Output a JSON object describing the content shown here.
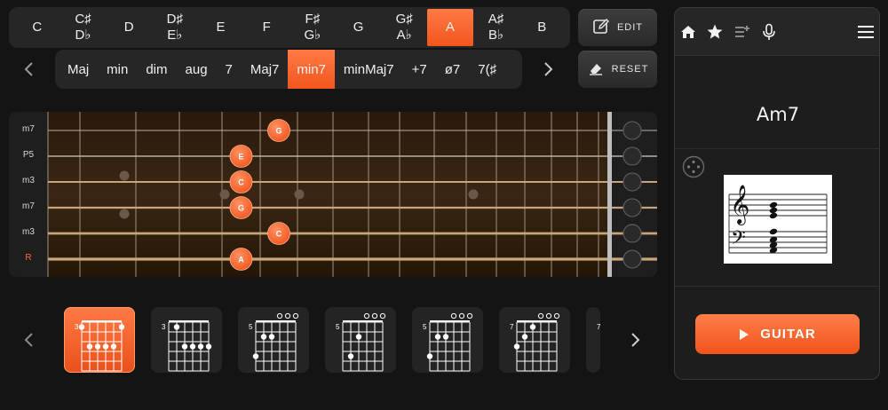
{
  "roots": [
    {
      "label": "C",
      "sub": "",
      "active": false
    },
    {
      "label": "C♯",
      "sub": "D♭",
      "active": false
    },
    {
      "label": "D",
      "sub": "",
      "active": false
    },
    {
      "label": "D♯",
      "sub": "E♭",
      "active": false
    },
    {
      "label": "E",
      "sub": "",
      "active": false
    },
    {
      "label": "F",
      "sub": "",
      "active": false
    },
    {
      "label": "F♯",
      "sub": "G♭",
      "active": false
    },
    {
      "label": "G",
      "sub": "",
      "active": false
    },
    {
      "label": "G♯",
      "sub": "A♭",
      "active": false
    },
    {
      "label": "A",
      "sub": "",
      "active": true
    },
    {
      "label": "A♯",
      "sub": "B♭",
      "active": false
    },
    {
      "label": "B",
      "sub": "",
      "active": false
    }
  ],
  "buttons": {
    "edit": "EDIT",
    "reset": "RESET",
    "play": "GUITAR"
  },
  "qualities": [
    {
      "label": "Maj",
      "active": false
    },
    {
      "label": "min",
      "active": false
    },
    {
      "label": "dim",
      "active": false
    },
    {
      "label": "aug",
      "active": false
    },
    {
      "label": "7",
      "active": false
    },
    {
      "label": "Maj7",
      "active": false
    },
    {
      "label": "min7",
      "active": true
    },
    {
      "label": "minMaj7",
      "active": false
    },
    {
      "label": "+7",
      "active": false
    },
    {
      "label": "ø7",
      "active": false
    },
    {
      "label": "7(♯",
      "active": false
    }
  ],
  "fretboard": {
    "string_labels": [
      "m7",
      "P5",
      "m3",
      "m7",
      "m3",
      "R"
    ],
    "root_string_index": 5,
    "notes": [
      {
        "string": 0,
        "fret": 6,
        "name": "G"
      },
      {
        "string": 1,
        "fret": 5,
        "name": "E"
      },
      {
        "string": 2,
        "fret": 5,
        "name": "C"
      },
      {
        "string": 3,
        "fret": 5,
        "name": "G"
      },
      {
        "string": 4,
        "fret": 6,
        "name": "C"
      },
      {
        "string": 5,
        "fret": 5,
        "name": "A"
      }
    ],
    "accent": "#f2561d"
  },
  "chord": {
    "name": "Am7"
  },
  "voicings": [
    {
      "fret_label": "3",
      "active": true
    },
    {
      "fret_label": "3",
      "active": false
    },
    {
      "fret_label": "5",
      "active": false
    },
    {
      "fret_label": "5",
      "active": false
    },
    {
      "fret_label": "5",
      "active": false
    },
    {
      "fret_label": "7",
      "active": false
    },
    {
      "fret_label": "7",
      "active": false
    }
  ]
}
